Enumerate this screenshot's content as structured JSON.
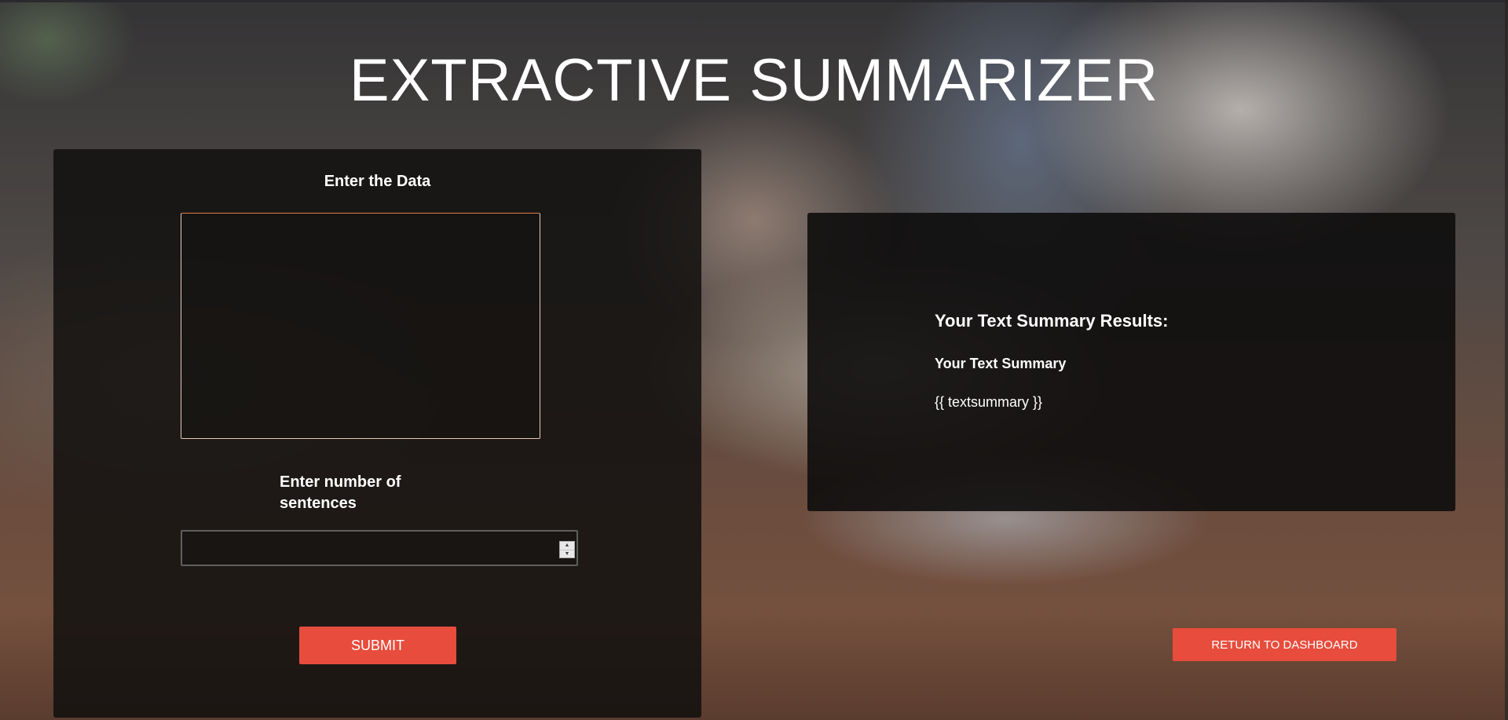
{
  "page": {
    "title": "EXTRACTIVE SUMMARIZER"
  },
  "input_form": {
    "data_label": "Enter the Data",
    "data_value": "",
    "sentences_label": "Enter number of sentences",
    "sentences_value": "",
    "submit_label": "SUBMIT"
  },
  "results": {
    "heading": "Your Text Summary Results:",
    "subheading": "Your Text Summary",
    "summary_text": "{{ textsummary }}"
  },
  "navigation": {
    "dashboard_label": "RETURN TO DASHBOARD"
  },
  "colors": {
    "accent": "#e74c3c",
    "panel": "#121010"
  }
}
